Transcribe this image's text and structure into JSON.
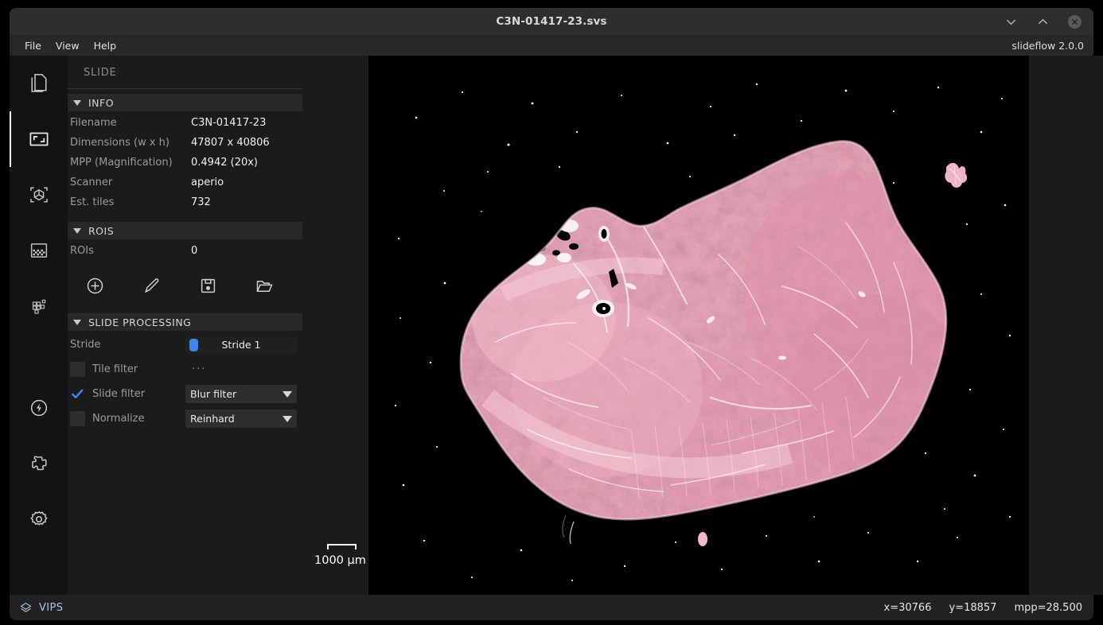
{
  "window": {
    "title": "C3N-01417-23.svs",
    "version_label": "slideflow 2.0.0",
    "controls": {
      "minimize": "chevron-down-icon",
      "maximize": "chevron-up-icon",
      "close": "close-icon"
    }
  },
  "menubar": {
    "items": [
      {
        "label": "File"
      },
      {
        "label": "View"
      },
      {
        "label": "Help"
      }
    ]
  },
  "rail": {
    "items": [
      {
        "name": "documents-icon",
        "active": false
      },
      {
        "name": "slide-icon",
        "active": true
      },
      {
        "name": "model-icon",
        "active": false
      },
      {
        "name": "mosaic-icon",
        "active": false
      },
      {
        "name": "heatmap-icon",
        "active": false
      },
      {
        "name": "performance-icon",
        "active": false
      },
      {
        "name": "extensions-icon",
        "active": false
      },
      {
        "name": "settings-icon",
        "active": false
      }
    ]
  },
  "panel": {
    "title": "SLIDE",
    "info": {
      "header": "INFO",
      "rows": [
        {
          "label": "Filename",
          "value": "C3N-01417-23"
        },
        {
          "label": "Dimensions (w x h)",
          "value": "47807 x 40806"
        },
        {
          "label": "MPP (Magnification)",
          "value": "0.4942 (20x)"
        },
        {
          "label": "Scanner",
          "value": "aperio"
        },
        {
          "label": "Est. tiles",
          "value": "732"
        }
      ]
    },
    "rois": {
      "header": "ROIS",
      "count_label": "ROIs",
      "count_value": "0",
      "tools": [
        {
          "name": "add-roi-icon"
        },
        {
          "name": "edit-roi-icon"
        },
        {
          "name": "save-roi-icon"
        },
        {
          "name": "load-roi-icon"
        }
      ]
    },
    "slide_processing": {
      "header": "SLIDE PROCESSING",
      "stride": {
        "label": "Stride",
        "value": "Stride 1"
      },
      "tile_filter": {
        "label": "Tile filter",
        "checked": false,
        "more": "···"
      },
      "slide_filter": {
        "label": "Slide filter",
        "checked": true,
        "value": "Blur filter"
      },
      "normalize": {
        "label": "Normalize",
        "checked": false,
        "value": "Reinhard"
      }
    }
  },
  "viewer": {
    "scalebar": {
      "label": "1000 µm"
    },
    "background": "#000000"
  },
  "statusbar": {
    "backend": "VIPS",
    "x": "x=30766",
    "y": "y=18857",
    "mpp": "mpp=28.500"
  },
  "colors": {
    "accent": "#3b88e8",
    "panel_bg": "#1b1b1b",
    "rail_bg": "#131313",
    "titlebar_bg": "#2e2e2e",
    "link": "#a8c4ea"
  }
}
